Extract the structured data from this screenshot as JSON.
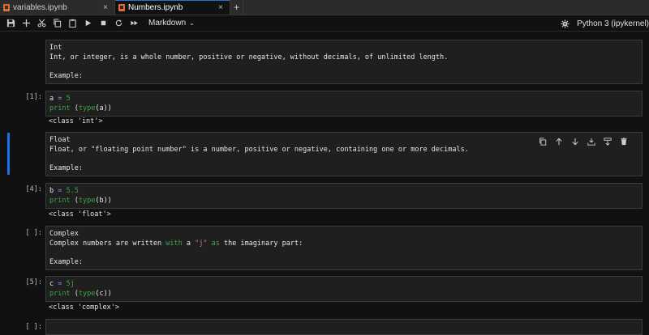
{
  "tabs": [
    {
      "label": "variables.ipynb",
      "close": "×",
      "active": false
    },
    {
      "label": "Numbers.ipynb",
      "close": "×",
      "active": true
    }
  ],
  "tab_add": "+",
  "toolbar": {
    "cell_type": "Markdown",
    "kernel": "Python 3 (ipykernel)"
  },
  "cells": {
    "int_md": {
      "prompt": "",
      "lines": [
        "Int",
        "Int, or integer, is a whole number, positive or negative, without decimals, of unlimited length.",
        "",
        "Example:"
      ]
    },
    "code1": {
      "prompt": "[1]:",
      "line1": {
        "var": "a",
        "op": "=",
        "val": "5"
      },
      "line2": {
        "fn": "print",
        "open": " (",
        "inner_fn": "type",
        "arg": "(a))"
      },
      "output": "<class 'int'>"
    },
    "float_md": {
      "prompt": "",
      "lines": [
        "Float",
        "Float, or \"floating point number\" is a number, positive or negative, containing one or more decimals.",
        "",
        "Example:"
      ]
    },
    "code2": {
      "prompt": "[4]:",
      "line1": {
        "var": "b",
        "op": "=",
        "val": "5.5"
      },
      "line2": {
        "fn": "print",
        "open": " (",
        "inner_fn": "type",
        "arg": "(b))"
      },
      "output": "<class 'float'>"
    },
    "complex_md": {
      "prompt": "[ ]:",
      "line1": "Complex",
      "line2_a": "Complex numbers are written ",
      "line2_b": "with",
      "line2_c": " a ",
      "line2_d": "\"j\"",
      "line2_e": " ",
      "line2_f": "as",
      "line2_g": " the imaginary part:",
      "line4": "Example:"
    },
    "code3": {
      "prompt": "[5]:",
      "line1": {
        "var": "c",
        "op": "=",
        "val": "5j"
      },
      "line2": {
        "fn": "print",
        "open": " (",
        "inner_fn": "type",
        "arg": "(c))"
      },
      "output": "<class 'complex'>"
    },
    "empty": {
      "prompt": "[ ]:"
    }
  },
  "colors": {
    "accent": "#1a73e8",
    "keyword": "#3fa447",
    "operator": "#c576f6",
    "string": "#e06c6c",
    "tab_icon": "#e46e2e"
  },
  "icons": {
    "toolbar": [
      "save-icon",
      "add-icon",
      "cut-icon",
      "copy-icon",
      "paste-icon",
      "run-icon",
      "stop-icon",
      "restart-icon",
      "fast-forward-icon"
    ],
    "cell_tools": [
      "duplicate-icon",
      "move-up-icon",
      "move-down-icon",
      "insert-above-icon",
      "insert-below-icon",
      "delete-icon"
    ]
  }
}
